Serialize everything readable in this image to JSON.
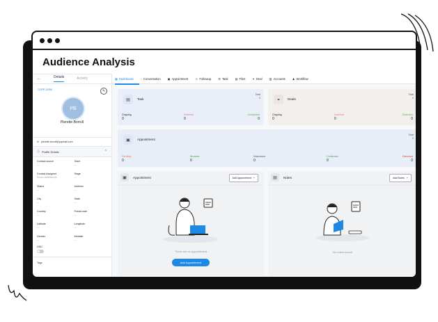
{
  "app": {
    "title": "Audience Analysis"
  },
  "sidebar": {
    "tabs": {
      "back": "←",
      "details": "Details",
      "activity": "Activity"
    },
    "contact_id": "CORP-12456",
    "avatar_initials": "PB",
    "name": "Pierette Borroll",
    "email": "pierette.borroll@yopmail.com",
    "section_title": "Profile Details",
    "fields": [
      {
        "label": "Contact source",
        "value": "—"
      },
      {
        "label": "Team",
        "value": "—"
      },
      {
        "label": "Contact Assigned",
        "value": "brook.cadadamps"
      },
      {
        "label": "Stage",
        "value": "—"
      },
      {
        "label": "Status",
        "value": "—"
      },
      {
        "label": "Address",
        "value": "—"
      },
      {
        "label": "City",
        "value": "—"
      },
      {
        "label": "State",
        "value": "—"
      },
      {
        "label": "Country",
        "value": "—"
      },
      {
        "label": "Postal code",
        "value": "—"
      },
      {
        "label": "Latitude",
        "value": "—"
      },
      {
        "label": "Longitude",
        "value": "—"
      },
      {
        "label": "Gender",
        "value": "—"
      },
      {
        "label": "Website",
        "value": "—"
      }
    ],
    "dnd_label": "DND",
    "tags_label": "Tags"
  },
  "nav": {
    "tabs": [
      "Dashboard",
      "Conversation",
      "Appointment",
      "Followup",
      "Task",
      "Files",
      "Deal",
      "Accounts",
      "Workflow"
    ],
    "active": "Dashboard"
  },
  "task_card": {
    "title": "Task",
    "total_label": "Total",
    "total": "0",
    "stats": [
      {
        "label": "Ongoing",
        "value": "0",
        "color": "#222222"
      },
      {
        "label": "Deferred",
        "value": "0",
        "color": "#e57373"
      },
      {
        "label": "Completed",
        "value": "0",
        "color": "#4caf50"
      }
    ]
  },
  "deals_card": {
    "title": "Deals",
    "total_label": "Total",
    "total": "0",
    "stats": [
      {
        "label": "Ongoing",
        "value": "0",
        "color": "#222222"
      },
      {
        "label": "Deal lost",
        "value": "0",
        "color": "#e57373"
      },
      {
        "label": "Deal won",
        "value": "0",
        "color": "#4caf50"
      }
    ]
  },
  "appointment_card": {
    "title": "Appointment",
    "total_label": "Total",
    "total": "0",
    "stats": [
      {
        "label": "Pending",
        "value": "0",
        "color": "#ef6c57"
      },
      {
        "label": "Showed",
        "value": "0",
        "color": "#43a047"
      },
      {
        "label": "Noshowed",
        "value": "0",
        "color": "#555555"
      },
      {
        "label": "Confirmed",
        "value": "0",
        "color": "#43a047"
      },
      {
        "label": "Canceled",
        "value": "0",
        "color": "#e53935"
      }
    ]
  },
  "appointment_panel": {
    "title": "Appointment",
    "add_button": "Add Appointment",
    "empty_text": "There are no Appointment",
    "primary_button": "Add Appointment"
  },
  "notes_panel": {
    "title": "Notes",
    "add_button": "Add Notes",
    "empty_text": "No notes found!"
  }
}
